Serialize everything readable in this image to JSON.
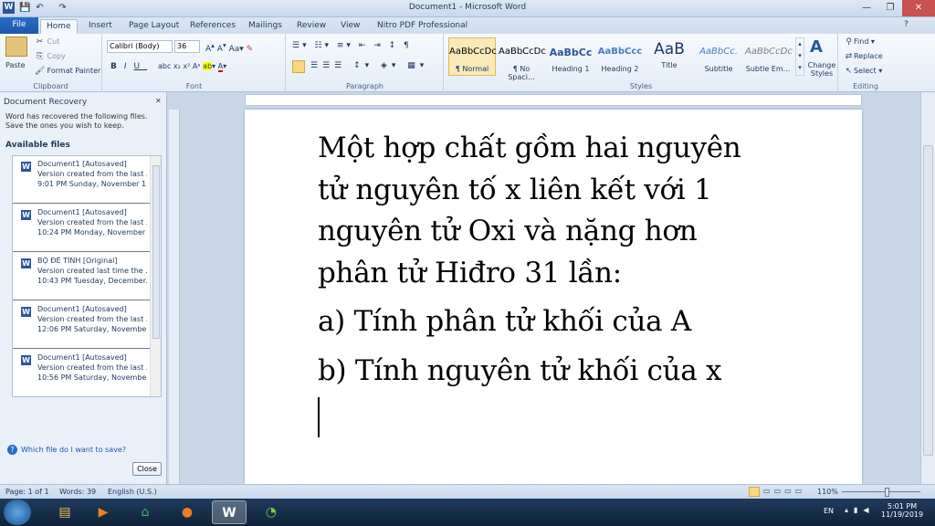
{
  "window": {
    "title": "Document1 - Microsoft Word"
  },
  "quick_access": {
    "word_icon": "W",
    "save": "💾",
    "undo": "↶",
    "redo": "↷"
  },
  "tabs": [
    "File",
    "Home",
    "Insert",
    "Page Layout",
    "References",
    "Mailings",
    "Review",
    "View",
    "Nitro PDF Professional"
  ],
  "ribbon": {
    "clipboard": {
      "paste": "Paste",
      "cut": "Cut",
      "copy": "Copy",
      "format_painter": "Format Painter",
      "label": "Clipboard"
    },
    "font": {
      "name": "Calibri (Body)",
      "size": "36",
      "label": "Font"
    },
    "paragraph": {
      "label": "Paragraph"
    },
    "styles": {
      "label": "Styles",
      "items": [
        {
          "preview": "AaBbCcDc",
          "name": "¶ Normal"
        },
        {
          "preview": "AaBbCcDc",
          "name": "¶ No Spaci..."
        },
        {
          "preview": "AaBbCc",
          "name": "Heading 1"
        },
        {
          "preview": "AaBbCcc",
          "name": "Heading 2"
        },
        {
          "preview": "AaB",
          "name": "Title"
        },
        {
          "preview": "AaBbCc.",
          "name": "Subtitle"
        },
        {
          "preview": "AaBbCcDc",
          "name": "Subtle Em..."
        }
      ],
      "change_styles": "Change Styles"
    },
    "editing": {
      "find": "Find",
      "replace": "Replace",
      "select": "Select",
      "label": "Editing"
    }
  },
  "recovery": {
    "title": "Document Recovery",
    "intro": "Word has recovered the following files. Save the ones you wish to keep.",
    "available": "Available files",
    "files": [
      {
        "name": "Document1 [Autosaved]",
        "line1": "Version created from the last ...",
        "line2": "9:01 PM Sunday, November 1..."
      },
      {
        "name": "Document1 [Autosaved]",
        "line1": "Version created from the last ...",
        "line2": "10:24 PM Monday, November ..."
      },
      {
        "name": "BỘ ĐỀ TỈNH [Original]",
        "line1": "Version created last time the ...",
        "line2": "10:43 PM Tuesday, December..."
      },
      {
        "name": "Document1 [Autosaved]",
        "line1": "Version created from the last ...",
        "line2": "12:06 PM Saturday, Novembe..."
      },
      {
        "name": "Document1 [Autosaved]",
        "line1": "Version created from the last ...",
        "line2": "10:56 PM Saturday, Novembe..."
      }
    ],
    "help_link": "Which file do I want to save?",
    "close": "Close"
  },
  "document": {
    "lines": [
      "Một hợp chất gồm hai nguyên",
      "tử nguyên tố x liên kết với 1",
      "nguyên tử Oxi và nặng hơn",
      "phân tử Hiđro 31 lần:",
      "a) Tính phân tử khối của A",
      "b) Tính nguyên tử khối của x"
    ]
  },
  "status": {
    "page": "Page: 1 of 1",
    "words": "Words: 39",
    "lang": "English (U.S.)",
    "zoom": "110%"
  },
  "taskbar": {
    "lang": "EN",
    "time": "5:01 PM",
    "date": "11/19/2019"
  },
  "colors": {
    "accent": "#2b579a",
    "file_tab": "#1c58ad"
  }
}
